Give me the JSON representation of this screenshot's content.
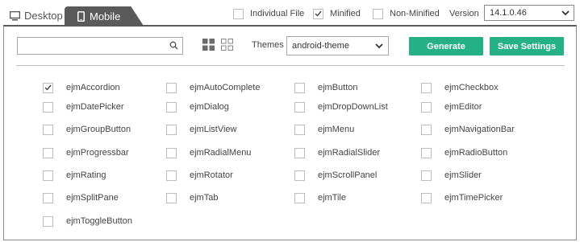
{
  "tabs": {
    "desktop": "Desktop",
    "mobile": "Mobile"
  },
  "options": {
    "individual_file": {
      "label": "Individual File",
      "checked": false
    },
    "minified": {
      "label": "Minified",
      "checked": true
    },
    "non_minified": {
      "label": "Non-Minified",
      "checked": false
    }
  },
  "version": {
    "label": "Version",
    "selected": "14.1.0.46"
  },
  "toolbar": {
    "search_value": "",
    "search_placeholder": "",
    "themes_label": "Themes",
    "theme_selected": "android-theme",
    "generate_label": "Generate",
    "save_label": "Save Settings"
  },
  "components": [
    {
      "label": "ejmAccordion",
      "checked": true
    },
    {
      "label": "ejmAutoComplete",
      "checked": false
    },
    {
      "label": "ejmButton",
      "checked": false
    },
    {
      "label": "ejmCheckbox",
      "checked": false
    },
    {
      "label": "ejmDatePicker",
      "checked": false
    },
    {
      "label": "ejmDialog",
      "checked": false
    },
    {
      "label": "ejmDropDownList",
      "checked": false
    },
    {
      "label": "ejmEditor",
      "checked": false
    },
    {
      "label": "ejmGroupButton",
      "checked": false
    },
    {
      "label": "ejmListView",
      "checked": false
    },
    {
      "label": "ejmMenu",
      "checked": false
    },
    {
      "label": "ejmNavigationBar",
      "checked": false
    },
    {
      "label": "ejmProgressbar",
      "checked": false
    },
    {
      "label": "ejmRadialMenu",
      "checked": false
    },
    {
      "label": "ejmRadialSlider",
      "checked": false
    },
    {
      "label": "ejmRadioButton",
      "checked": false
    },
    {
      "label": "ejmRating",
      "checked": false
    },
    {
      "label": "ejmRotator",
      "checked": false
    },
    {
      "label": "ejmScrollPanel",
      "checked": false
    },
    {
      "label": "ejmSlider",
      "checked": false
    },
    {
      "label": "ejmSplitPane",
      "checked": false
    },
    {
      "label": "ejmTab",
      "checked": false
    },
    {
      "label": "ejmTile",
      "checked": false
    },
    {
      "label": "ejmTimePicker",
      "checked": false
    },
    {
      "label": "ejmToggleButton",
      "checked": false
    }
  ],
  "colors": {
    "accent": "#26b086",
    "tab_active": "#5a5a5a"
  }
}
